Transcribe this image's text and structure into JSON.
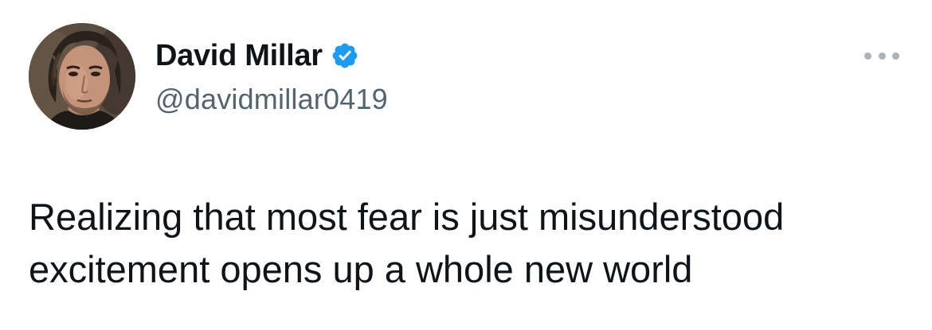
{
  "author": {
    "display_name": "David Millar",
    "handle": "@davidmillar0419",
    "verified": true,
    "avatar_icon": "profile-photo"
  },
  "tweet": {
    "text_line1": "Realizing that most fear is just misunderstood",
    "text_line2": "excitement opens up a whole new world"
  },
  "colors": {
    "primary_text": "#0f1419",
    "secondary_text": "#536471",
    "verified_blue": "#1d9bf0",
    "more_dots": "#aab3bb"
  },
  "icons": {
    "verified": "verified-badge-icon",
    "more": "more-options-icon"
  }
}
